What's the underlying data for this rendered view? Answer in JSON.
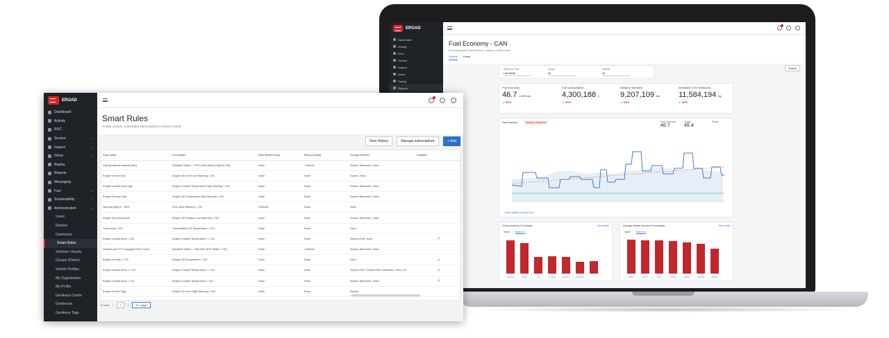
{
  "laptop": {
    "brand": "EROAD",
    "nav": [
      "Dashboard",
      "Activity",
      "RUC",
      "Service",
      "Inspect",
      "Driver",
      "Replay",
      "Reports"
    ],
    "title": "Fuel Economy - CAN",
    "subtitle": "Fuel consumption and emissions, based on CANbus data",
    "tabs": [
      "Vehicle",
      "Driver"
    ],
    "export_label": "Export",
    "filters": [
      {
        "label": "Period of Time",
        "value": "Last Month"
      },
      {
        "label": "Group",
        "value": "All"
      },
      {
        "label": "Vehicle",
        "value": "All"
      }
    ],
    "kpis": [
      {
        "label": "Fuel economy",
        "value": "46.7",
        "unit": "L/100 km",
        "delta": "100%"
      },
      {
        "label": "Fuel consumption",
        "value": "4,300,188",
        "unit": "L",
        "delta": "100%"
      },
      {
        "label": "Distance travelled",
        "value": "9,207,109",
        "unit": "km",
        "delta": "100%"
      },
      {
        "label": "Estimated CO2 emissions",
        "value": "11,584,194",
        "unit": "kg",
        "delta": "100%"
      }
    ],
    "fuel_card": {
      "title": "Fuel economy",
      "tag": "Attention Required",
      "kp1_label": "Fuel economy",
      "kp1_value": "46.7",
      "kp2_label": "Target",
      "kp2_value": "45.4",
      "kp3_label": "Trend",
      "footer": "More insights coming soon"
    },
    "bottom_left": {
      "title": "Group economy % vs target",
      "link": "View detail",
      "tabs": [
        "Top 5",
        "Bottom 5"
      ],
      "bars": [
        80,
        74,
        40,
        42,
        40,
        28,
        30
      ],
      "labels": [
        "Singapore",
        "Vehicle",
        "Test",
        "Jongkum",
        "Zamobie",
        "Whangarei",
        ""
      ]
    },
    "bottom_right": {
      "title": "Average vehicle economy % vs targets",
      "link": "View detail",
      "tabs": [
        "Top 5",
        "Bottom 5"
      ],
      "bars": [
        82,
        80,
        80,
        78,
        75,
        72,
        60
      ],
      "labels": [
        "HBX72",
        "NTT75",
        "CTTH",
        "HPP10",
        "HDE12",
        "XMOE25",
        "FRBT5"
      ]
    }
  },
  "window": {
    "brand": "EROAD",
    "nav": [
      {
        "label": "Dashboard",
        "chev": false,
        "sub": false
      },
      {
        "label": "Activity",
        "chev": false,
        "sub": false
      },
      {
        "label": "RUC",
        "chev": false,
        "sub": false
      },
      {
        "label": "Service",
        "chev": true,
        "sub": false
      },
      {
        "label": "Inspect",
        "chev": true,
        "sub": false
      },
      {
        "label": "Driver",
        "chev": true,
        "sub": false
      },
      {
        "label": "Replay",
        "chev": false,
        "sub": false
      },
      {
        "label": "Reports",
        "chev": false,
        "sub": false
      },
      {
        "label": "Messaging",
        "chev": false,
        "sub": false
      },
      {
        "label": "Fuel",
        "chev": true,
        "sub": false
      },
      {
        "label": "Sustainability",
        "chev": true,
        "sub": false
      },
      {
        "label": "Administration",
        "chev": true,
        "sub": false
      },
      {
        "label": "Users",
        "chev": false,
        "sub": true
      },
      {
        "label": "Ehubos",
        "chev": false,
        "sub": true
      },
      {
        "label": "Dashcams",
        "chev": false,
        "sub": true
      },
      {
        "label": "Smart Rules",
        "chev": false,
        "sub": true
      },
      {
        "label": "Vehicles / Assets",
        "chev": false,
        "sub": true
      },
      {
        "label": "Groups (Fleets)",
        "chev": false,
        "sub": true
      },
      {
        "label": "Vehicle Profiles",
        "chev": false,
        "sub": true
      },
      {
        "label": "My Organisation",
        "chev": false,
        "sub": true
      },
      {
        "label": "My Profile",
        "chev": false,
        "sub": true
      },
      {
        "label": "Geofence Centre",
        "chev": false,
        "sub": true
      },
      {
        "label": "Geofences",
        "chev": false,
        "sub": true
      },
      {
        "label": "Geofence Tags",
        "chev": false,
        "sub": true
      }
    ],
    "title": "Smart Rules",
    "subtitle": "Create custom, automated alerts based on sensor events",
    "buttons": {
      "history": "View History",
      "subs": "Manage subscriptions",
      "add": "+ Add"
    },
    "columns": [
      "Rule name",
      "If condition",
      "Alert Reset Every",
      "Record Delay",
      "Groups (Fleets)",
      "Enabled"
    ],
    "rows": [
      [
        "Driving without seatbelt (test)",
        "(Seatbelt Switch = OFF) AND (Wheel Speed >25)",
        "None",
        "1 Minute",
        "Scania, Mercedes, Volvo",
        ""
      ],
      [
        "Engine oil level low",
        "Engine Oil Level Low Warning = ON",
        "None",
        "None",
        "Scania, Volvo",
        ""
      ],
      [
        "Engine coolant temp high",
        "Engine Coolant Temperature High Warning = ON",
        "None",
        "None",
        "Scania, Mercedes, Volvo",
        ""
      ],
      [
        "Engine oil temp high",
        "Engine Oil Temperature High Warning = ON",
        "None",
        "None",
        "Scania, Mercedes, Volvo",
        ""
      ],
      [
        "Warning light on - RED",
        "Red Lamp Warning = ON",
        "5 Minute",
        "None",
        "Volvo",
        ""
      ],
      [
        "Engine low oil pressure",
        "Engine Oil Pressure Low Warning = ON",
        "None",
        "None",
        "Scania, Mercedes, Volvo",
        ""
      ],
      [
        "Trans temp >113",
        "Transmission Oil Temperature > 113",
        "None",
        "None",
        "Volvo",
        ""
      ],
      [
        "Engine coolant temp > 100",
        "Engine Coolant Temperature >= 100",
        "None",
        "None",
        "Scania 2018, Volvo",
        "✓"
      ],
      [
        "Seatbelt and PTO engaged (Test 3 min)",
        "(Seatbelt Switch = ON) AND (PTO State = ON)",
        "None",
        "1 Minute",
        "Scania, Mercedes, Volvo",
        ""
      ],
      [
        "Engine oil temp > 120",
        "Engine Oil Temperature > 120",
        "None",
        "None",
        "Volvo",
        "✓"
      ],
      [
        "Engine coolant temp >= 110",
        "Engine Coolant Temperature >= 110",
        "None",
        "None",
        "Scania 2022, Scania 2020, Mercedes, Volvo, Sc",
        "✓"
      ],
      [
        "Engine coolant temp > 115",
        "Engine Coolant Temperature > 115",
        "None",
        "None",
        "Scania, Mercedes, Volvo",
        "✓"
      ],
      [
        "Engine oil level high",
        "Engine Oil Level High Warning = ON",
        "None",
        "None",
        "Scania",
        ""
      ]
    ],
    "pager": {
      "total": "12 total",
      "page": "1",
      "per_page": "10 / page"
    }
  }
}
